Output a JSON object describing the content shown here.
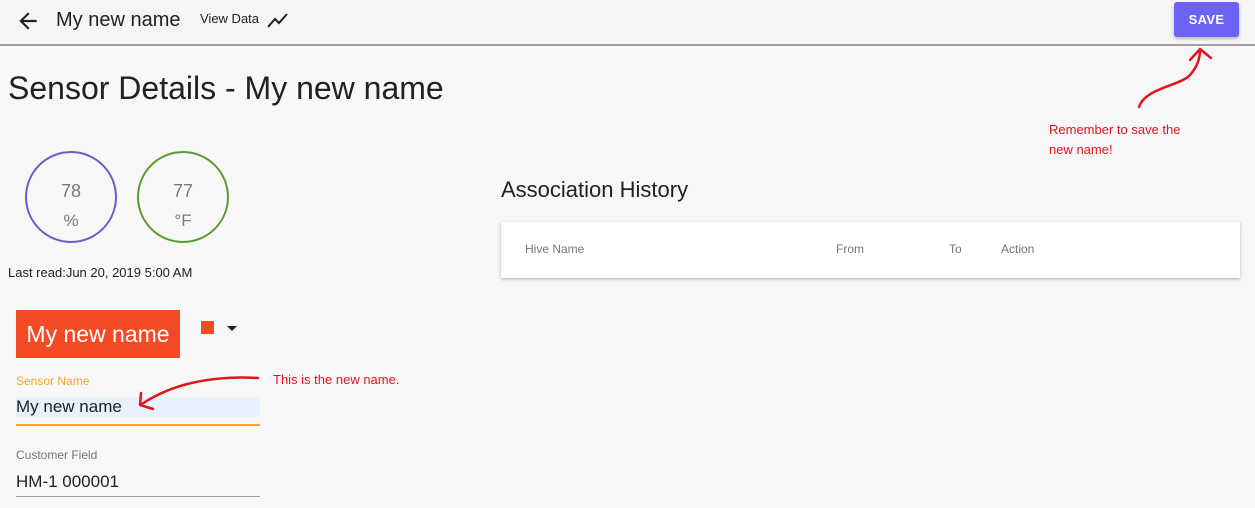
{
  "header": {
    "title": "My new name",
    "view_data_label": "View Data",
    "save_label": "SAVE"
  },
  "page": {
    "title": "Sensor Details - My new name"
  },
  "gauges": {
    "humidity": {
      "value": "78",
      "unit": "%",
      "color": "#6b5cc8"
    },
    "temperature": {
      "value": "77",
      "unit": "°F",
      "color": "#5a9b30"
    }
  },
  "last_read": "Last read:Jun 20, 2019 5:00 AM",
  "name_chip": {
    "label": "My new name",
    "color": "#f24a24"
  },
  "form": {
    "sensor_name_label": "Sensor Name",
    "sensor_name_value": "My new name",
    "customer_field_label": "Customer Field",
    "customer_field_value": "HM-1 000001"
  },
  "association": {
    "title": "Association History",
    "columns": [
      "Hive Name",
      "From",
      "To",
      "Action"
    ]
  },
  "annotations": {
    "save_note": "Remember to save the new name!",
    "name_note": "This is the new name."
  },
  "colors": {
    "accent": "#6c63f5",
    "focus": "#f5a623",
    "annotation": "#e3141c"
  }
}
